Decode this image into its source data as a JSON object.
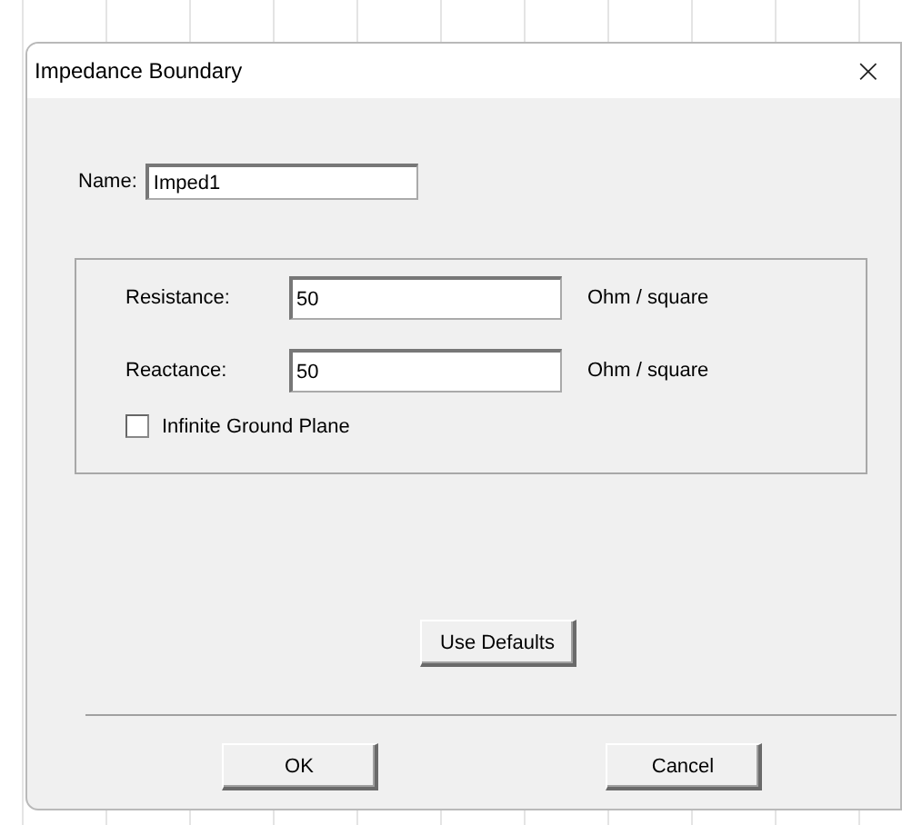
{
  "window": {
    "title": "Impedance Boundary",
    "close": "×"
  },
  "name_field": {
    "label": "Name:",
    "value": "Imped1"
  },
  "fields": [
    {
      "label": "Resistance:",
      "value": "50",
      "unit": "Ohm / square"
    },
    {
      "label": "Reactance:",
      "value": "50",
      "unit": "Ohm / square"
    }
  ],
  "infinite_ground_plane": {
    "label": "Infinite Ground Plane",
    "checked": false
  },
  "defaults_button": "Use Defaults",
  "buttons": [
    "OK",
    "Cancel"
  ]
}
